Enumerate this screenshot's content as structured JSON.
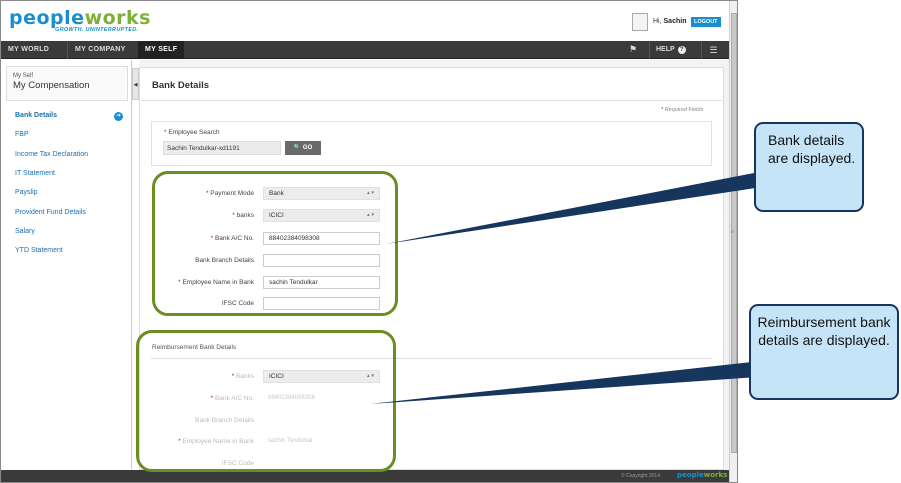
{
  "header": {
    "logo_text_a": "pe",
    "logo_text_b": "ople",
    "logo_text_c": "works",
    "tagline": "GROWTH. UNINTERRUPTED.",
    "greeting_prefix": "Hi,",
    "user_name": "Sachin",
    "logout_label": "LOGOUT"
  },
  "nav": {
    "tabs": [
      {
        "label": "MY WORLD"
      },
      {
        "label": "MY COMPANY"
      },
      {
        "label": "MY SELF"
      }
    ],
    "help_label": "HELP"
  },
  "sidebar": {
    "section_small": "My Self",
    "section_title": "My Compensation",
    "items": [
      {
        "label": "Bank Details"
      },
      {
        "label": "FBP"
      },
      {
        "label": "Income Tax Declaration"
      },
      {
        "label": "IT Statement"
      },
      {
        "label": "Payslip"
      },
      {
        "label": "Provident Fund Details"
      },
      {
        "label": "Salary"
      },
      {
        "label": "YTD Statement"
      }
    ]
  },
  "main": {
    "title": "Bank Details",
    "required_note": "Required Fields",
    "search": {
      "label": "Employee Search",
      "value": "Sachin Tendulkar-xd1191",
      "go_label": "GO"
    },
    "bank_form": {
      "payment_mode_label": "Payment Mode",
      "payment_mode_value": "Bank",
      "banks_label": "banks",
      "banks_value": "ICICI",
      "account_label": "Bank A/C No.",
      "account_value": "88402384098308",
      "branch_label": "Bank Branch Details",
      "branch_value": "",
      "name_label": "Employee Name in Bank",
      "name_value": "sachin Tendulkar",
      "ifsc_label": "IFSC Code",
      "ifsc_value": ""
    },
    "reimbursement": {
      "title": "Reimbursement Bank Details",
      "banks_label": "Banks",
      "banks_value": "ICICI",
      "account_label": "Bank A/C No.",
      "account_value": "88402384098308",
      "branch_label": "Bank Branch Details",
      "name_label": "Employee Name in Bank",
      "name_value": "sachin Tendulkar",
      "ifsc_label": "IFSC Code"
    }
  },
  "footer": {
    "copyright": "© Copyright 2014",
    "logo_a": "people",
    "logo_b": "works"
  },
  "annotations": {
    "callout_bank": "Bank details are displayed.",
    "callout_reimb": "Reimbursement bank details are displayed."
  },
  "colors": {
    "brand_blue": "#1a8ecf",
    "brand_green": "#7db037",
    "nav_dark": "#3a3a3a",
    "ring_green": "#6b8e23",
    "callout_fill": "#c6e4f7",
    "callout_border": "#17365d",
    "required_red": "#cc1111"
  },
  "icons": [
    "flag-icon",
    "help-icon",
    "menu-icon",
    "arrow-right-icon",
    "search-icon",
    "select-caret-icon",
    "collapse-arrow-icon",
    "avatar"
  ]
}
